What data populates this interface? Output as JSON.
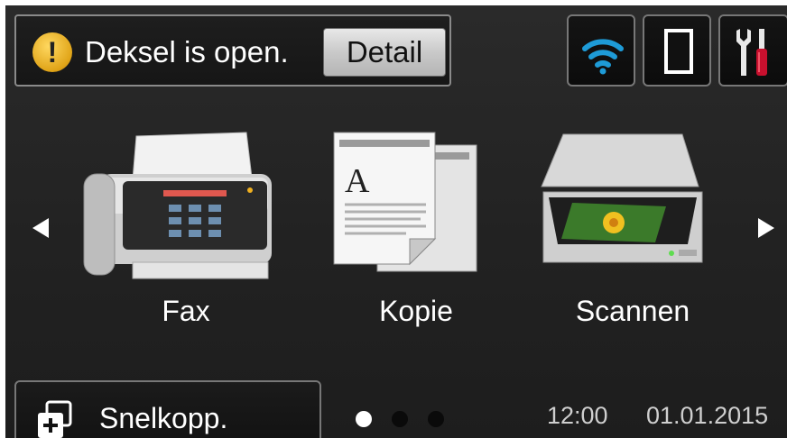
{
  "status": {
    "message": "Deksel is open.",
    "detail_label": "Detail"
  },
  "top_icons": [
    "wifi-icon",
    "toner-icon",
    "settings-icon"
  ],
  "apps": [
    {
      "label": "Fax",
      "icon": "fax-icon"
    },
    {
      "label": "Kopie",
      "icon": "copy-icon"
    },
    {
      "label": "Scannen",
      "icon": "scanner-icon"
    }
  ],
  "bottom": {
    "shortcut_label": "Snelkopp.",
    "page_count": 3,
    "active_page": 1,
    "time": "12:00",
    "date": "01.01.2015"
  },
  "colors": {
    "wifi": "#1e9bd7",
    "warning": "#e0a418",
    "tool_red": "#c8102e"
  }
}
